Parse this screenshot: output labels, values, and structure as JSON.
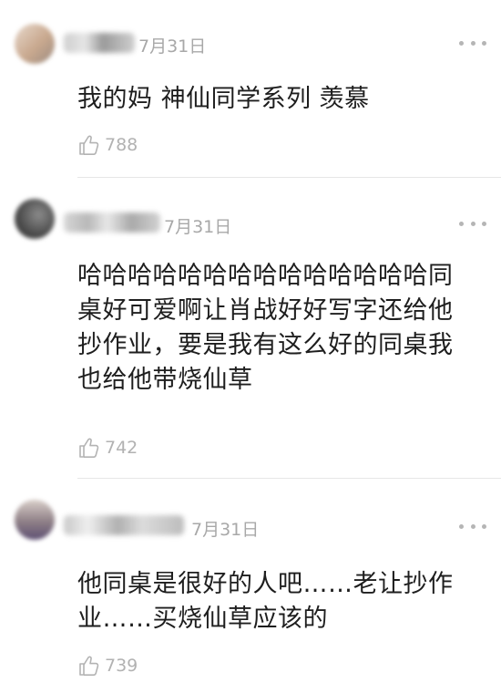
{
  "comments": [
    {
      "date": "7月31日",
      "text": "我的妈 神仙同学系列 羡慕",
      "likes": "788",
      "more_icon": "more-dots-icon",
      "like_icon": "thumbs-up-icon"
    },
    {
      "date": "7月31日",
      "text": "哈哈哈哈哈哈哈哈哈哈哈哈哈哈同桌好可爱啊让肖战好好写字还给他抄作业，要是我有这么好的同桌我也给他带烧仙草",
      "likes": "742",
      "more_icon": "more-dots-icon",
      "like_icon": "thumbs-up-icon"
    },
    {
      "date": "7月31日",
      "text": "他同桌是很好的人吧……老让抄作业……买烧仙草应该的",
      "likes": "739",
      "more_icon": "more-dots-icon",
      "like_icon": "thumbs-up-icon"
    }
  ]
}
